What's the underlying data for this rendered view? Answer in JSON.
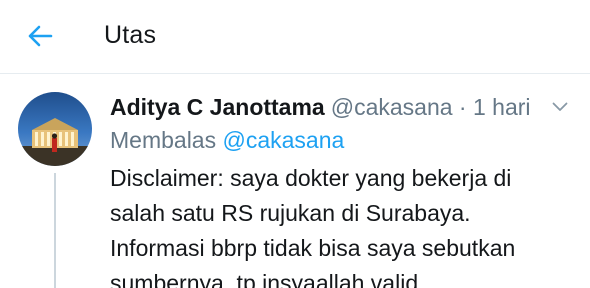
{
  "header": {
    "title": "Utas",
    "back_icon": "arrow-left-icon",
    "accent_color": "#1da1f2"
  },
  "tweet": {
    "author": {
      "name": "Aditya C Janottama",
      "handle": "@cakasana",
      "avatar_icon": "avatar-photo"
    },
    "separator": "·",
    "timestamp": "1 hari",
    "caret_icon": "chevron-down-icon",
    "reply": {
      "prefix": "Membalas",
      "mention": "@cakasana"
    },
    "text_lines": [
      "Disclaimer: saya dokter yang bekerja di",
      "salah satu RS rujukan di Surabaya.",
      "Informasi bbrp tidak bisa saya sebutkan",
      "sumbernya, tp insyaallah valid."
    ]
  },
  "colors": {
    "text_primary": "#14171a",
    "text_secondary": "#657786",
    "divider": "#e6ecf0",
    "thread_line": "#ccd6dd"
  }
}
